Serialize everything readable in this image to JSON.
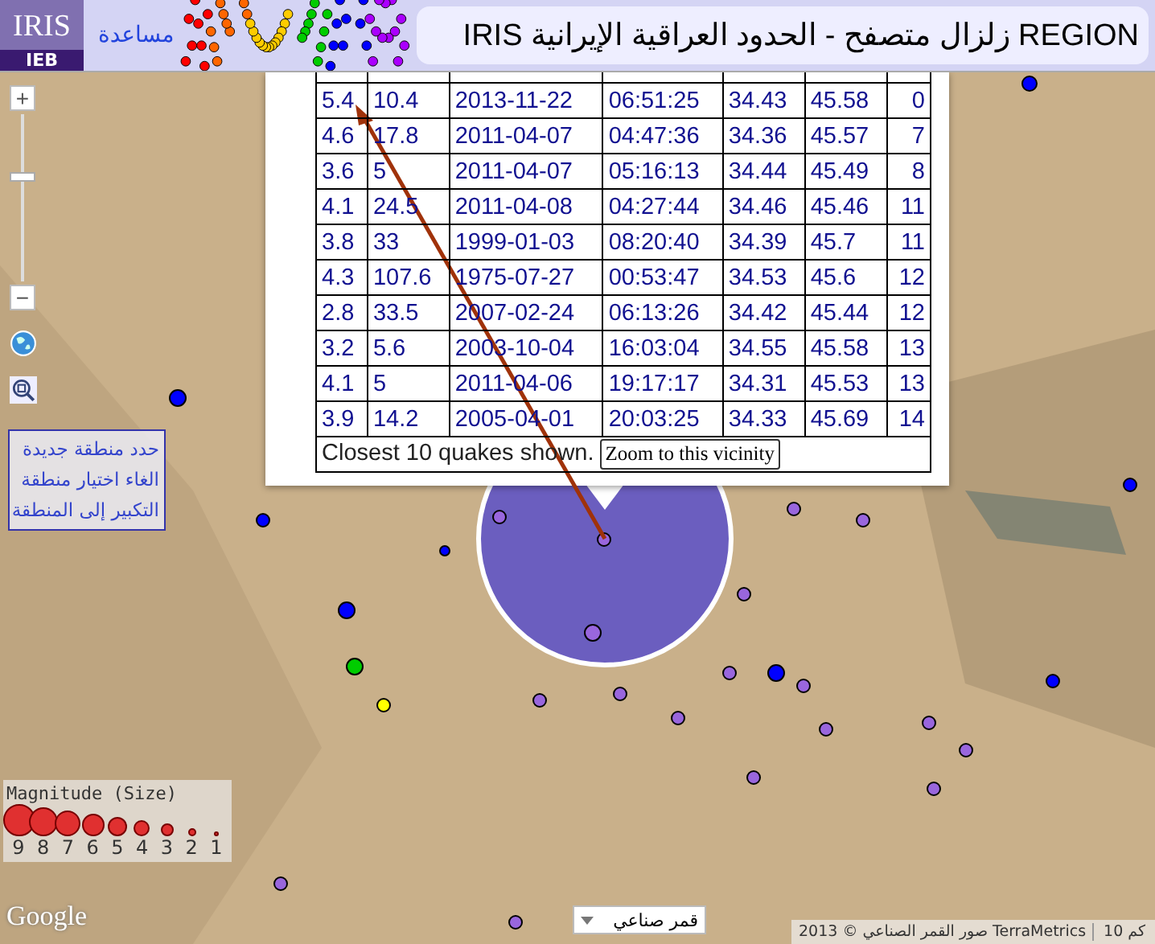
{
  "header": {
    "logo_text": "IRIS",
    "logo_badge": "IEB",
    "help_link": "مساعدة",
    "title": "IRIS زلزال متصفح - الحدود العراقية الإيرانية REGION"
  },
  "map_controls": {
    "zoom_in": "+",
    "zoom_out": "−",
    "zoom_slider": {
      "level": 0.63
    }
  },
  "selection_links": [
    "حدد منطقة جديدة",
    "الغاء اختيار منطقة",
    "التكبير إلى المنطقة"
  ],
  "popup": {
    "rows": [
      [
        "5.4",
        "10.4",
        "2013-11-22",
        "06:51:25",
        "34.43",
        "45.58",
        "0"
      ],
      [
        "4.6",
        "17.8",
        "2011-04-07",
        "04:47:36",
        "34.36",
        "45.57",
        "7"
      ],
      [
        "3.6",
        "5",
        "2011-04-07",
        "05:16:13",
        "34.44",
        "45.49",
        "8"
      ],
      [
        "4.1",
        "24.5",
        "2011-04-08",
        "04:27:44",
        "34.46",
        "45.46",
        "11"
      ],
      [
        "3.8",
        "33",
        "1999-01-03",
        "08:20:40",
        "34.39",
        "45.7",
        "11"
      ],
      [
        "4.3",
        "107.6",
        "1975-07-27",
        "00:53:47",
        "34.53",
        "45.6",
        "12"
      ],
      [
        "2.8",
        "33.5",
        "2007-02-24",
        "06:13:26",
        "34.42",
        "45.44",
        "12"
      ],
      [
        "3.2",
        "5.6",
        "2003-10-04",
        "16:03:04",
        "34.55",
        "45.58",
        "13"
      ],
      [
        "4.1",
        "5",
        "2011-04-06",
        "19:17:17",
        "34.31",
        "45.53",
        "13"
      ],
      [
        "3.9",
        "14.2",
        "2005-04-01",
        "20:03:25",
        "34.33",
        "45.69",
        "14"
      ]
    ],
    "footer_text": "Closest 10 quakes shown.",
    "zoom_button": "Zoom to this vicinity"
  },
  "legend": {
    "title": "Magnitude (Size)",
    "labels": [
      "9",
      "8",
      "7",
      "6",
      "5",
      "4",
      "3",
      "2",
      "1"
    ]
  },
  "google_logo": "Google",
  "map_type": {
    "value": "قمر صناعي"
  },
  "attribution": "صور القمر الصناعي © 2013 TerraMetrics",
  "scale": "10 كم"
}
